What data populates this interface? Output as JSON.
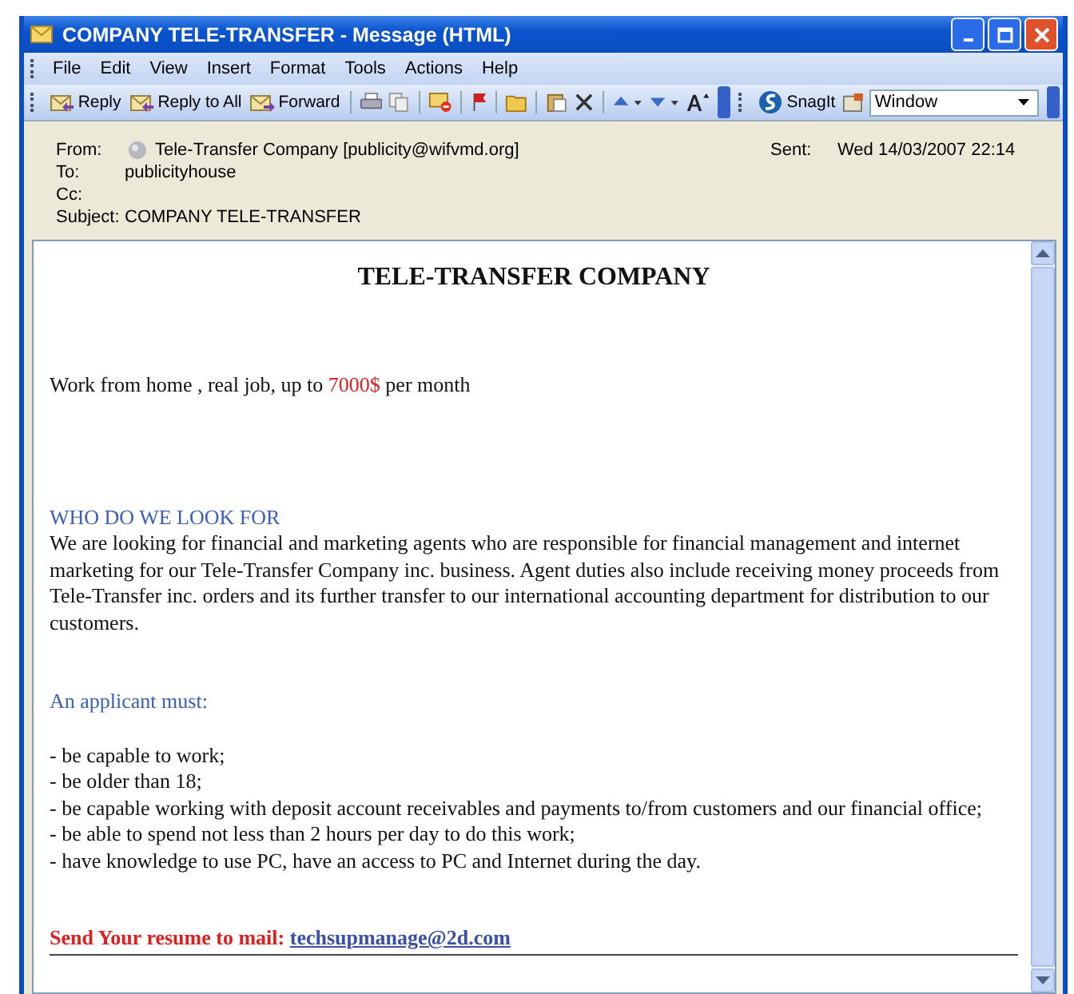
{
  "window": {
    "title": "COMPANY TELE-TRANSFER - Message (HTML)"
  },
  "menu": [
    "File",
    "Edit",
    "View",
    "Insert",
    "Format",
    "Tools",
    "Actions",
    "Help"
  ],
  "toolbar": {
    "buttons": [
      "Reply",
      "Reply to All",
      "Forward"
    ],
    "snagit": "SnagIt",
    "dropdown": {
      "value": "Window"
    }
  },
  "header": {
    "from_label": "From:",
    "from": "Tele-Transfer Company [publicity@wifvmd.org]",
    "sent_label": "Sent:",
    "sent": "Wed 14/03/2007 22:14",
    "to_label": "To:",
    "to": "publicityhouse",
    "cc_label": "Cc:",
    "subject_label": "Subject:",
    "subject": "COMPANY TELE-TRANSFER"
  },
  "message": {
    "heading": "TELE-TRANSFER COMPANY",
    "intro": {
      "before": "Work from home , real job, up to ",
      "highlight": "7000$",
      "after": " per month"
    },
    "section_title": "WHO DO WE LOOK FOR",
    "paragraph": "We are looking for financial and marketing agents who are responsible for financial management and internet marketing for our Tele-Transfer Company inc. business. Agent duties also include receiving money proceeds from Tele-Transfer inc. orders and its further transfer to our international accounting department for distribution to our customers.",
    "requirements_title": "An applicant must:",
    "requirements": [
      "- be capable to work;",
      "- be older than 18;",
      "- be capable working with deposit account receivables and payments to/from customers and our financial office;",
      "- be able to spend not less than 2 hours per day to do this work;",
      "- have knowledge to use PC, have an access to PC and Internet during the day."
    ],
    "contact": {
      "prompt": "Send Your resume to mail: ",
      "email": "techsupmanage@2d.com"
    }
  }
}
